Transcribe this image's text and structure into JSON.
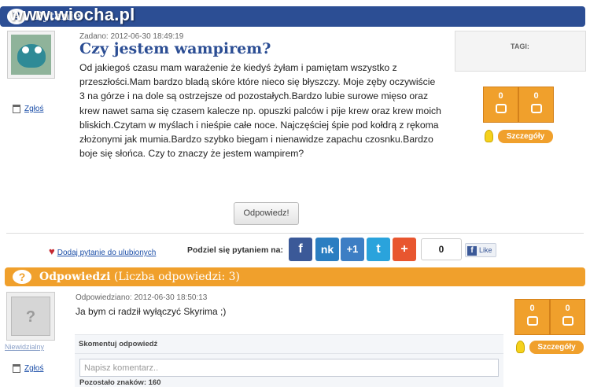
{
  "question_bar": {
    "label": "Pytanie",
    "watermark": "www.wiocha.pl"
  },
  "question": {
    "meta": "Zadano: 2012-06-30 18:49:19",
    "title": "Czy jestem wampirem?",
    "body": "Od jakiegoś czasu mam warażenie że kiedyś żyłam i pamiętam wszystko z przeszłości.Mam bardzo bladą skóre które nieco się błyszczy. Moje zęby oczywiście 3 na górze i na dole są ostrzejsze od pozostałych.Bardzo lubie surowe mięso oraz krew nawet sama się czasem kalecze np. opuszki palców i pije krew oraz krew moich bliskich.Czytam w myślach i nieśpie całe noce. Najczęściej śpie pod kołdrą z rękoma złożonymi jak mumia.Bardzo szybko biegam i nienawidze zapachu czosnku.Bardzo boje się słońca. Czy to znaczy że jestem wampirem?",
    "report_label": "Zgłoś",
    "tags_label": "TAGI:",
    "votes_up": "0",
    "votes_down": "0",
    "details_label": "Szczegóły",
    "answer_button": "Odpowiedz!"
  },
  "share": {
    "favorite_label": "Dodaj pytanie do ulubionych",
    "share_label": "Podziel się pytaniem na:",
    "buttons": {
      "facebook": "f",
      "nk": "nk",
      "gplus": "+1",
      "twitter": "t",
      "plus": "+"
    },
    "count": "0",
    "like_label": "Like"
  },
  "answers": {
    "title_bold": "Odpowiedzi",
    "title_rest": "(Liczba odpowiedzi: 3)",
    "items": [
      {
        "meta": "Odpowiedziano: 2012-06-30 18:50:13",
        "username": "Niewidzialny",
        "body": "Ja bym ci radził wyłączyć Skyrima ;)",
        "report_label": "Zgłoś",
        "votes_up": "0",
        "votes_down": "0",
        "details_label": "Szczegóły",
        "comment_header": "Skomentuj odpowiedź",
        "comment_placeholder": "Napisz komentarz..",
        "remaining_label": "Pozostało znaków:",
        "remaining_value": "160"
      }
    ]
  },
  "colors": {
    "blue_bar": "#2c4e94",
    "orange": "#f0a02c",
    "link": "#1c4fa8"
  },
  "icons": [
    "question-icon",
    "trash-icon",
    "thumb-up-icon",
    "thumb-down-icon",
    "bulb-icon",
    "heart-icon",
    "facebook-icon",
    "nk-icon",
    "gplus-icon",
    "twitter-icon",
    "plus-icon"
  ]
}
